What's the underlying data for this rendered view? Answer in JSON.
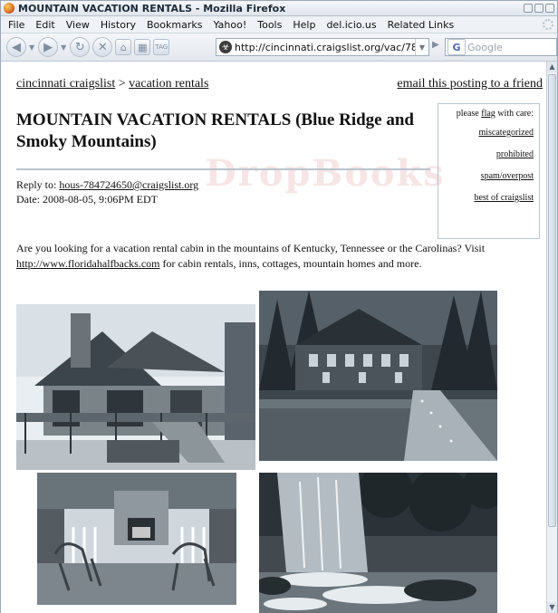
{
  "window": {
    "title": "MOUNTAIN VACATION RENTALS - Mozilla Firefox"
  },
  "menu": [
    "File",
    "Edit",
    "View",
    "History",
    "Bookmarks",
    "Yahoo!",
    "Tools",
    "Help",
    "del.icio.us",
    "Related Links"
  ],
  "toolbar": {
    "tag_label": "TAG",
    "url": "http://cincinnati.craigslist.org/vac/78",
    "search_placeholder": "Google",
    "search_engine_letter": "G"
  },
  "page": {
    "breadcrumb_site": "cincinnati craigslist",
    "breadcrumb_sep": ">",
    "breadcrumb_section": "vacation rentals",
    "email_link": "email this posting to a friend",
    "title": "MOUNTAIN VACATION RENTALS (Blue Ridge and Smoky Mountains)",
    "reply_label": "Reply to:",
    "reply_email": "hous-784724650@craigslist.org",
    "date": "Date: 2008-08-05, 9:06PM EDT",
    "flag": {
      "prefix": "please",
      "flag_word": "flag",
      "suffix": "with care:",
      "links": [
        "miscategorized",
        "prohibited",
        "spam/overpost",
        "best of craigslist"
      ]
    },
    "body_1": "Are you looking for a vacation rental cabin in the mountains of Kentucky, Tennessee or the Carolinas? Visit",
    "body_link": "http://www.floridahalfbacks.com",
    "body_2": "for cabin rentals, inns, cottages, mountain homes and more.",
    "watermark": "DropBooks"
  },
  "colors": {
    "chrome": "#e3e8ee",
    "border": "#9aa7b6"
  }
}
